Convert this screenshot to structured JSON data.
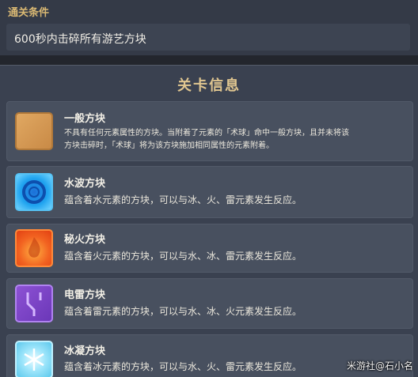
{
  "condition": {
    "title": "通关条件",
    "text": "600秒内击碎所有游艺方块"
  },
  "panel": {
    "title": "关卡信息",
    "cards": [
      {
        "name": "一般方块",
        "desc_line1": "不具有任何元素属性的方块。当附着了元素的「术球」命中一般方块，且并未将该",
        "desc_line2": "方块击碎时，「术球」将为该方块施加相同属性的元素附着。",
        "icon": "normal-block-icon"
      },
      {
        "name": "水波方块",
        "desc_line1": "蕴含着水元素的方块，可以与冰、火、雷元素发生反应。",
        "icon": "hydro-block-icon"
      },
      {
        "name": "秘火方块",
        "desc_line1": "蕴含着火元素的方块，可以与水、冰、雷元素发生反应。",
        "icon": "pyro-block-icon"
      },
      {
        "name": "电雷方块",
        "desc_line1": "蕴含着雷元素的方块，可以与水、冰、火元素发生反应。",
        "icon": "electro-block-icon"
      },
      {
        "name": "冰凝方块",
        "desc_line1": "蕴含着冰元素的方块，可以与水、火、雷元素发生反应。",
        "icon": "cryo-block-icon"
      }
    ]
  },
  "watermark": "米游社@石小名"
}
